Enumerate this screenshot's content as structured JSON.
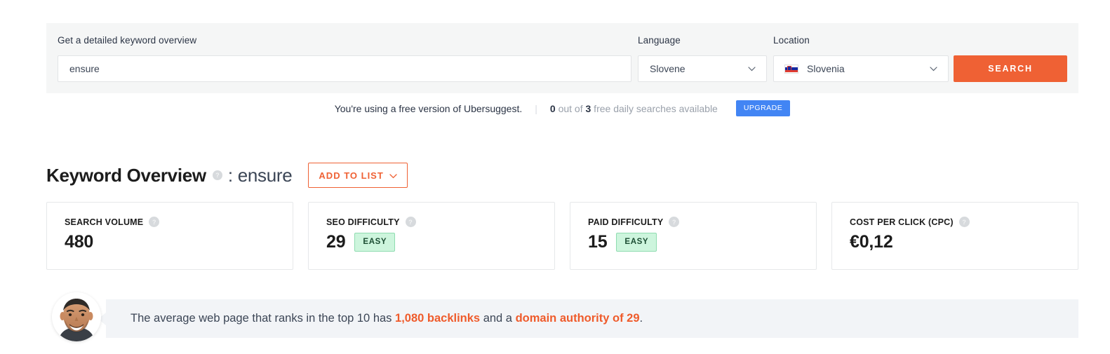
{
  "search_panel": {
    "keyword_label": "Get a detailed keyword overview",
    "keyword_value": "ensure",
    "keyword_placeholder": "Enter a keyword",
    "language_label": "Language",
    "language_value": "Slovene",
    "location_label": "Location",
    "location_value": "Slovenia",
    "location_flag": "slovenia-flag-icon",
    "search_button": "SEARCH",
    "chevron_icon": "chevron-down-icon",
    "accent_color": "#ef6134"
  },
  "notice": {
    "message": "You're using a free version of Ubersuggest.",
    "separator": "|",
    "searches_used": "0",
    "searches_mid": " out of ",
    "searches_total": "3",
    "searches_suffix": " free daily searches available",
    "upgrade_button": "UPGRADE",
    "upgrade_color": "#4285f4"
  },
  "overview": {
    "title": "Keyword Overview",
    "help_icon": "help-circle-icon",
    "separator": ": ",
    "keyword": "ensure",
    "add_to_list_button": "ADD TO LIST",
    "add_to_list_chevron": "chevron-down-icon"
  },
  "metrics": [
    {
      "label": "SEARCH VOLUME",
      "help_icon": "help-circle-icon",
      "value": "480",
      "badge": ""
    },
    {
      "label": "SEO DIFFICULTY",
      "help_icon": "help-circle-icon",
      "value": "29",
      "badge": "EASY"
    },
    {
      "label": "PAID DIFFICULTY",
      "help_icon": "help-circle-icon",
      "value": "15",
      "badge": "EASY"
    },
    {
      "label": "COST PER CLICK (CPC)",
      "help_icon": "help-circle-icon",
      "value": "€0,12",
      "badge": ""
    }
  ],
  "insight": {
    "avatar": "user-avatar",
    "text_1": "The average web page that ranks in the top 10 has ",
    "highlight_1": "1,080 backlinks",
    "text_2": " and a ",
    "highlight_2": "domain authority of 29",
    "text_3": ".",
    "highlight_color": "#ef5b2b"
  }
}
